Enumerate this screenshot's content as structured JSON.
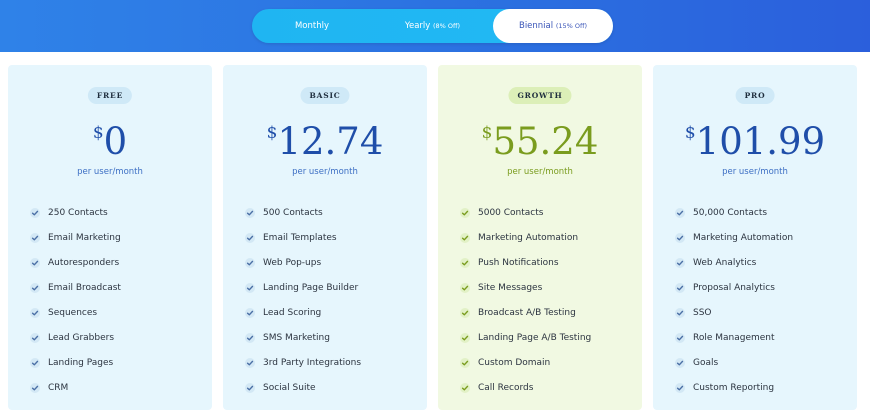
{
  "billing_toggle": {
    "options": [
      {
        "label": "Monthly",
        "discount": ""
      },
      {
        "label": "Yearly",
        "discount": "(8% Off)"
      },
      {
        "label": "Biennial",
        "discount": "(15% Off)"
      }
    ],
    "selected": "Biennial"
  },
  "colors": {
    "header_blue": "#2b6fe0",
    "toggle_cyan": "#22b9f4",
    "card_blue": "#e6f6fd",
    "card_green": "#f1f9e2",
    "price_blue": "#1f4ea9",
    "price_green": "#7a9c1e"
  },
  "plans": [
    {
      "name": "FREE",
      "currency": "$",
      "price": "0",
      "period": "per user/month",
      "features": [
        "250 Contacts",
        "Email Marketing",
        "Autoresponders",
        "Email Broadcast",
        "Sequences",
        "Lead Grabbers",
        "Landing Pages",
        "CRM"
      ]
    },
    {
      "name": "BASIC",
      "currency": "$",
      "price": "12.74",
      "period": "per user/month",
      "features": [
        "500 Contacts",
        "Email Templates",
        "Web Pop-ups",
        "Landing Page Builder",
        "Lead Scoring",
        "SMS Marketing",
        "3rd Party Integrations",
        "Social Suite"
      ]
    },
    {
      "name": "GROWTH",
      "currency": "$",
      "price": "55.24",
      "period": "per user/month",
      "features": [
        "5000 Contacts",
        "Marketing Automation",
        "Push Notifications",
        "Site Messages",
        "Broadcast A/B Testing",
        "Landing Page A/B Testing",
        "Custom Domain",
        "Call Records"
      ]
    },
    {
      "name": "PRO",
      "currency": "$",
      "price": "101.99",
      "period": "per user/month",
      "features": [
        "50,000 Contacts",
        "Marketing Automation",
        "Web Analytics",
        "Proposal Analytics",
        "SSO",
        "Role Management",
        "Goals",
        "Custom Reporting"
      ]
    }
  ]
}
